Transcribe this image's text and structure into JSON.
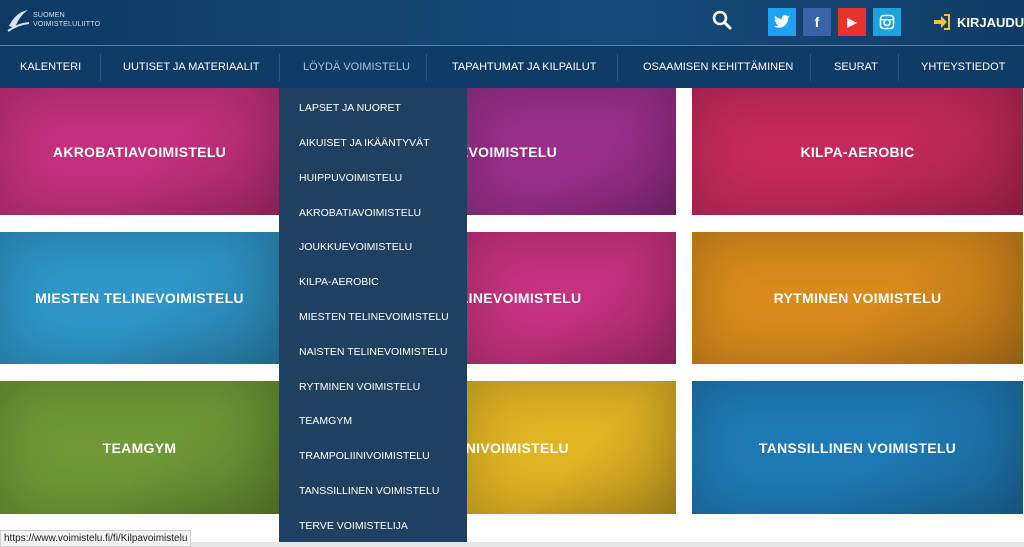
{
  "header": {
    "logo_line1": "SUOMEN",
    "logo_line2": "VOIMISTELULIITTO",
    "login_label": "KIRJAUDU",
    "social": {
      "twitter": "t",
      "facebook": "f",
      "youtube": "▶",
      "instagram": "◎"
    }
  },
  "nav": {
    "items": [
      {
        "label": "KALENTERI"
      },
      {
        "label": "UUTISET JA MATERIAALIT"
      },
      {
        "label": "LÖYDÄ VOIMISTELU"
      },
      {
        "label": "TAPAHTUMAT JA KILPAILUT"
      },
      {
        "label": "OSAAMISEN KEHITTÄMINEN"
      },
      {
        "label": "SEURAT"
      },
      {
        "label": "YHTEYSTIEDOT"
      }
    ],
    "active_index": 2
  },
  "dropdown": {
    "items": [
      "LAPSET JA NUORET",
      "AIKUISET JA IKÄÄNTYVÄT",
      "HUIPPUVOIMISTELU",
      "AKROBATIAVOIMISTELU",
      "JOUKKUEVOIMISTELU",
      "KILPA-AEROBIC",
      "MIESTEN TELINEVOIMISTELU",
      "NAISTEN TELINEVOIMISTELU",
      "RYTMINEN VOIMISTELU",
      "TEAMGYM",
      "TRAMPOLIINIVOIMISTELU",
      "TANSSILLINEN VOIMISTELU",
      "TERVE VOIMISTELIJA"
    ]
  },
  "tiles": [
    {
      "label": "AKROBATIAVOIMISTELU",
      "color": "#c5317e"
    },
    {
      "label": "JOUKKUEVOIMISTELU",
      "color": "#9b2f8c"
    },
    {
      "label": "KILPA-AEROBIC",
      "color": "#c52a5b"
    },
    {
      "label": "MIESTEN TELINEVOIMISTELU",
      "color": "#2f97c9"
    },
    {
      "label": "NAISTEN TELINEVOIMISTELU",
      "color": "#c5327f"
    },
    {
      "label": "RYTMINEN VOIMISTELU",
      "color": "#d98b1c"
    },
    {
      "label": "TEAMGYM",
      "color": "#6f9a37"
    },
    {
      "label": "TRAMPOLIINIVOIMISTELU",
      "color": "#e2b524"
    },
    {
      "label": "TANSSILLINEN VOIMISTELU",
      "color": "#1f7bb6"
    }
  ],
  "status_bar": {
    "url": "https://www.voimistelu.fi/fi/Kilpavoimistelu"
  },
  "colors": {
    "header_bg": "#0f3c66",
    "dropdown_bg": "#123458",
    "login_icon": "#f2c230"
  }
}
